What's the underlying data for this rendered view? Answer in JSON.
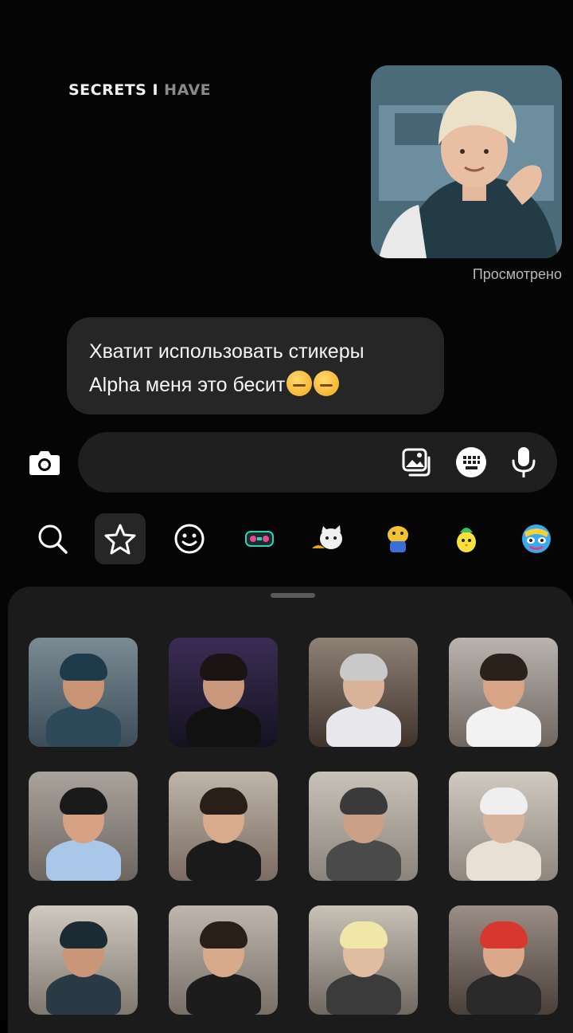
{
  "watermark": {
    "bright": "SECRETS I",
    "dim": " HAVE"
  },
  "sent_sticker": {
    "name": "sent-sticker"
  },
  "status": {
    "seen": "Просмотрено"
  },
  "message": {
    "line1": "Хватит использовать стикеры",
    "line2": "Alpha меня это бесит"
  },
  "composer": {
    "placeholder": ""
  },
  "icons": {
    "camera": "camera-icon",
    "gallery": "gallery-icon",
    "sticker_keyboard": "keyboard-icon",
    "microphone": "microphone-icon",
    "search": "search-icon",
    "favorites": "star-icon",
    "emoji": "smiley-icon"
  },
  "colors": {
    "background": "#050505",
    "bubble": "#262626",
    "composer": "#1f1f1f",
    "sheet": "#1b1b1b",
    "seen_text": "#b8b8b8"
  },
  "sticker_grid": {
    "tiles": [
      {
        "bg1": "#7a8b93",
        "bg2": "#3c4d58",
        "skin": "#c89474",
        "hair": "#1f3a4a",
        "shirt": "#2e4a5a"
      },
      {
        "bg1": "#3a2d55",
        "bg2": "#15121f",
        "skin": "#c9987c",
        "hair": "#1a1414",
        "shirt": "#111111"
      },
      {
        "bg1": "#8e8176",
        "bg2": "#3f342c",
        "skin": "#d8b39a",
        "hair": "#c9c9c9",
        "shirt": "#e8e8ec"
      },
      {
        "bg1": "#b9b4b0",
        "bg2": "#6f665f",
        "skin": "#d7a586",
        "hair": "#2b211b",
        "shirt": "#f2f2f2"
      },
      {
        "bg1": "#a9a39c",
        "bg2": "#6d6660",
        "skin": "#d6a283",
        "hair": "#1a1a1a",
        "shirt": "#a9c7e8"
      },
      {
        "bg1": "#bfb5aa",
        "bg2": "#7a6c62",
        "skin": "#d8ab8c",
        "hair": "#2a1e18",
        "shirt": "#1a1a1a"
      },
      {
        "bg1": "#c8c2b8",
        "bg2": "#8a847b",
        "skin": "#caa087",
        "hair": "#3a3a3a",
        "shirt": "#4a4a4a"
      },
      {
        "bg1": "#d0cac0",
        "bg2": "#8f877d",
        "skin": "#d6b39a",
        "hair": "#efefef",
        "shirt": "#e9dfd4"
      },
      {
        "bg1": "#cfc9c0",
        "bg2": "#7f786f",
        "skin": "#c9967a",
        "hair": "#1b2a33",
        "shirt": "#2a3a44"
      },
      {
        "bg1": "#bfb7ad",
        "bg2": "#786f66",
        "skin": "#d7aa8b",
        "hair": "#2a1f18",
        "shirt": "#1c1c1c"
      },
      {
        "bg1": "#c9c2b7",
        "bg2": "#6f6860",
        "skin": "#e0bca0",
        "hair": "#f0e6a8",
        "shirt": "#3b3b3b"
      },
      {
        "bg1": "#9a8e86",
        "bg2": "#4a403a",
        "skin": "#dba88a",
        "hair": "#d8372f",
        "shirt": "#2a2a2a"
      }
    ]
  },
  "sticker_packs": [
    {
      "name": "pack-robot",
      "color": "#2bd3b8"
    },
    {
      "name": "pack-cat",
      "color": "#e8e8e8"
    },
    {
      "name": "pack-blob",
      "color": "#f2c230"
    },
    {
      "name": "pack-chick",
      "color": "#f6e23a"
    },
    {
      "name": "pack-monster",
      "color": "#3aa9f0"
    }
  ]
}
